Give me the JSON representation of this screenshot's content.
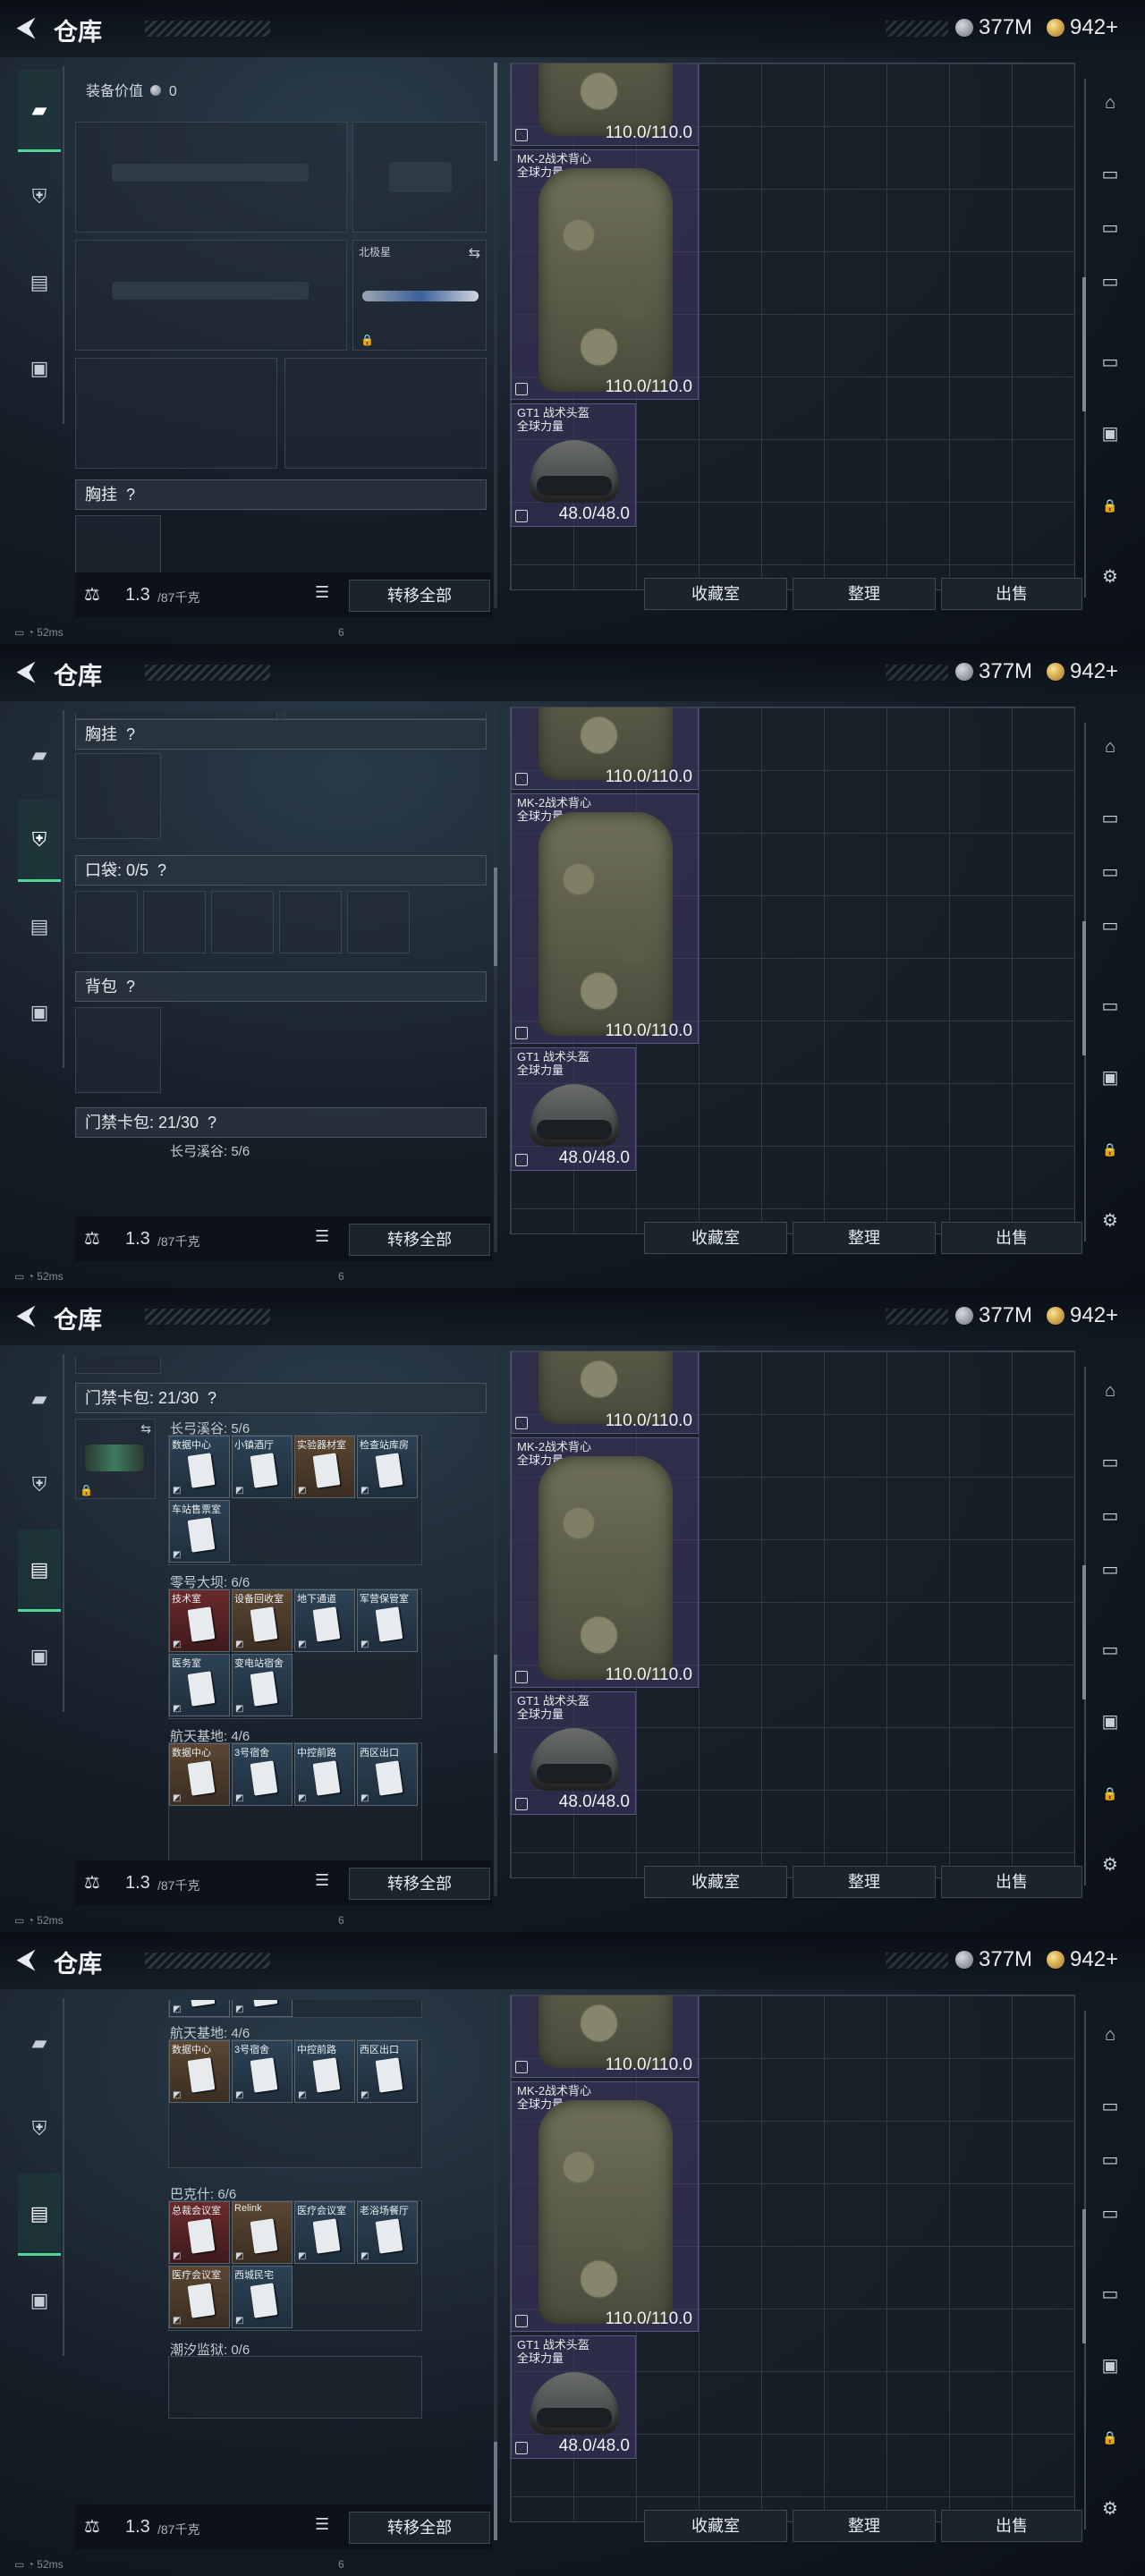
{
  "header": {
    "title": "仓库",
    "silver": "377M",
    "gold": "942+"
  },
  "status": {
    "ping": "52ms",
    "page_indicator": "6"
  },
  "equipment": {
    "value_label": "装备价值",
    "value": "0",
    "melee_name": "北极星",
    "chest_rig_label": "胸挂",
    "question": "?",
    "pockets_label": "口袋: 0/5",
    "backpack_label": "背包",
    "keycard_label": "门禁卡包: 21/30"
  },
  "keycards": {
    "groups": [
      {
        "title": "长弓溪谷: 5/6",
        "cards": [
          {
            "name": "数据中心",
            "color": "blue"
          },
          {
            "name": "小镇酒厅",
            "color": "blue"
          },
          {
            "name": "实验器材室",
            "color": "gold"
          },
          {
            "name": "检查站库房",
            "color": "blue"
          },
          {
            "name": "车站售票室",
            "color": "blue"
          }
        ]
      },
      {
        "title": "零号大坝: 6/6",
        "cards": [
          {
            "name": "技术室",
            "color": "red"
          },
          {
            "name": "设备回收室",
            "color": "gold"
          },
          {
            "name": "地下通道",
            "color": "blue"
          },
          {
            "name": "军营保管室",
            "color": "blue"
          },
          {
            "name": "医务室",
            "color": "blue"
          },
          {
            "name": "变电站宿舍",
            "color": "blue"
          }
        ]
      },
      {
        "title": "航天基地: 4/6",
        "cards": [
          {
            "name": "数据中心",
            "color": "gold"
          },
          {
            "name": "3号宿舍",
            "color": "blue"
          },
          {
            "name": "中控前路",
            "color": "blue"
          },
          {
            "name": "西区出口",
            "color": "blue"
          }
        ]
      },
      {
        "title": "巴克什: 6/6",
        "cards": [
          {
            "name": "总裁会议室",
            "color": "red"
          },
          {
            "name": "Relink",
            "color": "gold"
          },
          {
            "name": "医疗会议室",
            "color": "blue"
          },
          {
            "name": "老浴场餐厅",
            "color": "blue"
          },
          {
            "name": "医疗会议室",
            "color": "gold"
          },
          {
            "name": "西城民宅",
            "color": "blue"
          }
        ]
      },
      {
        "title": "潮汐监狱: 0/6",
        "cards": []
      }
    ]
  },
  "footer": {
    "weight": "1.3",
    "weight_max": "/87千克",
    "transfer_all": "转移全部"
  },
  "stash": {
    "items": [
      {
        "name_line1": "",
        "name_line2": "",
        "value": "110.0/110.0"
      },
      {
        "name_line1": "MK-2战术背心",
        "name_line2": "全球力量",
        "value": "110.0/110.0"
      },
      {
        "name_line1": "GT1 战术头盔",
        "name_line2": "全球力量",
        "value": "48.0/48.0"
      }
    ],
    "buttons": {
      "collection": "收藏室",
      "sort": "整理",
      "sell": "出售"
    }
  }
}
